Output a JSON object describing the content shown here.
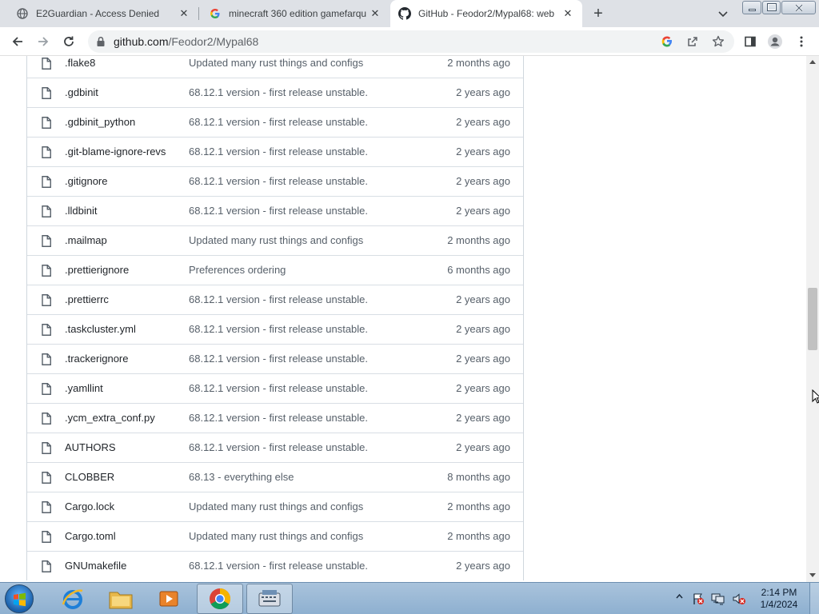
{
  "tabs": [
    {
      "title": "E2Guardian - Access Denied",
      "icon": "globe-icon"
    },
    {
      "title": "minecraft 360 edition gamefarqu",
      "icon": "google-g-icon"
    },
    {
      "title": "GitHub - Feodor2/Mypal68: web",
      "icon": "github-icon"
    }
  ],
  "tab_close_glyph": "✕",
  "new_tab_glyph": "+",
  "address": {
    "host": "github.com",
    "path": "/Feodor2/Mypal68"
  },
  "files": [
    {
      "name": ".flake8",
      "message": "Updated many rust things and configs",
      "age": "2 months ago"
    },
    {
      "name": ".gdbinit",
      "message": "68.12.1 version - first release unstable.",
      "age": "2 years ago"
    },
    {
      "name": ".gdbinit_python",
      "message": "68.12.1 version - first release unstable.",
      "age": "2 years ago"
    },
    {
      "name": ".git-blame-ignore-revs",
      "message": "68.12.1 version - first release unstable.",
      "age": "2 years ago"
    },
    {
      "name": ".gitignore",
      "message": "68.12.1 version - first release unstable.",
      "age": "2 years ago"
    },
    {
      "name": ".lldbinit",
      "message": "68.12.1 version - first release unstable.",
      "age": "2 years ago"
    },
    {
      "name": ".mailmap",
      "message": "Updated many rust things and configs",
      "age": "2 months ago"
    },
    {
      "name": ".prettierignore",
      "message": "Preferences ordering",
      "age": "6 months ago"
    },
    {
      "name": ".prettierrc",
      "message": "68.12.1 version - first release unstable.",
      "age": "2 years ago"
    },
    {
      "name": ".taskcluster.yml",
      "message": "68.12.1 version - first release unstable.",
      "age": "2 years ago"
    },
    {
      "name": ".trackerignore",
      "message": "68.12.1 version - first release unstable.",
      "age": "2 years ago"
    },
    {
      "name": ".yamllint",
      "message": "68.12.1 version - first release unstable.",
      "age": "2 years ago"
    },
    {
      "name": ".ycm_extra_conf.py",
      "message": "68.12.1 version - first release unstable.",
      "age": "2 years ago"
    },
    {
      "name": "AUTHORS",
      "message": "68.12.1 version - first release unstable.",
      "age": "2 years ago"
    },
    {
      "name": "CLOBBER",
      "message": "68.13 - everything else",
      "age": "8 months ago"
    },
    {
      "name": "Cargo.lock",
      "message": "Updated many rust things and configs",
      "age": "2 months ago"
    },
    {
      "name": "Cargo.toml",
      "message": "Updated many rust things and configs",
      "age": "2 months ago"
    },
    {
      "name": "GNUmakefile",
      "message": "68.12.1 version - first release unstable.",
      "age": "2 years ago"
    }
  ],
  "taskbar": {
    "apps": [
      "internet-explorer-icon",
      "file-explorer-icon",
      "media-player-icon",
      "chrome-icon",
      "keyboard-app-icon"
    ],
    "time": "2:14 PM",
    "date": "1/4/2024"
  },
  "colors": {
    "accent": "#1a73e8",
    "tabstrip": "#dee1e6",
    "taskbar": "#9dbad6"
  }
}
